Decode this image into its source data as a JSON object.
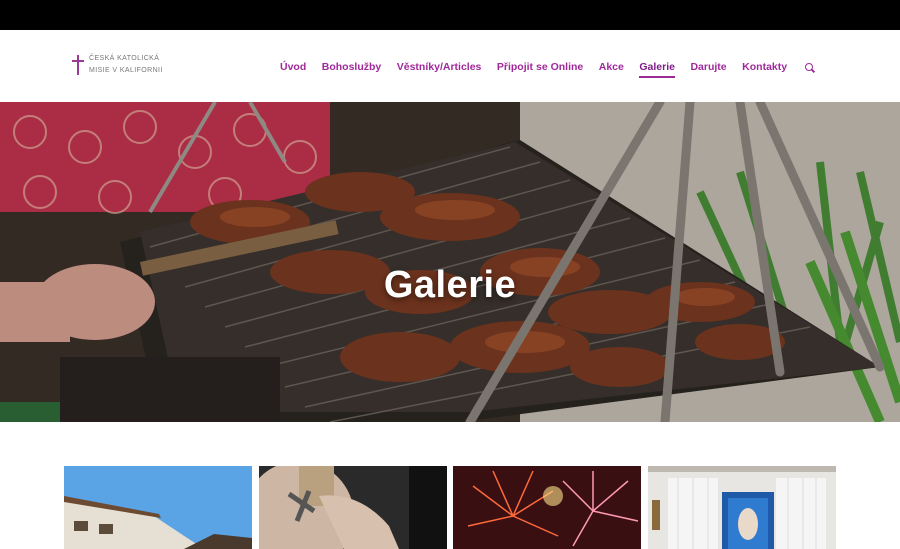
{
  "site": {
    "logo_line1": "ČESKÁ KATOLICKÁ",
    "logo_line2": "MISIE V KALIFORNII"
  },
  "nav": {
    "items": [
      {
        "label": "Úvod"
      },
      {
        "label": "Bohoslužby"
      },
      {
        "label": "Věstníky/Articles"
      },
      {
        "label": "Připojit se Online"
      },
      {
        "label": "Akce"
      },
      {
        "label": "Galerie",
        "active": true
      },
      {
        "label": "Darujte"
      },
      {
        "label": "Kontakty"
      }
    ],
    "search_icon": "search-icon"
  },
  "hero": {
    "title": "Galerie"
  },
  "colors": {
    "accent": "#a0299a",
    "active_underline": "#9b2c94",
    "topbar": "#000000"
  }
}
